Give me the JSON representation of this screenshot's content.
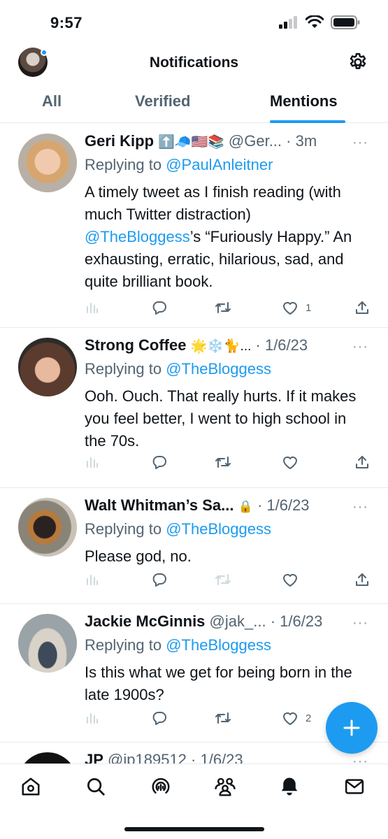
{
  "status_bar": {
    "time": "9:57"
  },
  "header": {
    "title": "Notifications"
  },
  "tabs": [
    {
      "label": "All",
      "active": false
    },
    {
      "label": "Verified",
      "active": false
    },
    {
      "label": "Mentions",
      "active": true
    }
  ],
  "tweets": [
    {
      "name": "Geri Kipp",
      "name_emoji": "⬆️🧢🇺🇸📚",
      "handle": "@Ger...",
      "time": "· 3m",
      "reply_prefix": "Replying to",
      "reply_to": "@PaulAnleitner",
      "body_parts": [
        "A timely tweet as I finish reading (with much Twitter distraction) ",
        "@TheBloggess",
        "’s “Furiously Happy.” An exhausting, erratic, hilarious, sad, and quite brilliant book."
      ],
      "likes": "1"
    },
    {
      "name": "Strong Coffee",
      "name_emoji": "🌟❄️🐈...",
      "handle": "",
      "time": "· 1/6/23",
      "reply_prefix": "Replying to",
      "reply_to": "@TheBloggess",
      "body": "Ooh. Ouch. That really hurts. If it makes you feel better, I went to high school in the 70s.",
      "likes": ""
    },
    {
      "name": "Walt Whitman’s Sa...",
      "name_emoji": "🔒",
      "handle": "",
      "time": "· 1/6/23",
      "reply_prefix": "Replying to",
      "reply_to": "@TheBloggess",
      "body": "Please god, no.",
      "likes": ""
    },
    {
      "name": "Jackie McGinnis",
      "name_emoji": "",
      "handle": "@jak_...",
      "time": "· 1/6/23",
      "reply_prefix": "Replying to",
      "reply_to": "@TheBloggess",
      "body": "Is this what we get for being born in the late 1900s?",
      "likes": "2"
    },
    {
      "name": "JP",
      "name_emoji": "",
      "handle": "@jp189512",
      "time": "· 1/6/23"
    }
  ],
  "more_label": "···",
  "colors": {
    "accent": "#1d9bf0",
    "text": "#0f1419",
    "muted": "#536471",
    "divider": "#e6e9ec"
  },
  "icons": {
    "header": [
      "settings-gear-icon"
    ],
    "tweet_actions": [
      "analytics-icon",
      "reply-icon",
      "retweet-icon",
      "like-icon",
      "share-icon"
    ],
    "tabbar": [
      "home-icon",
      "search-icon",
      "spaces-icon",
      "communities-icon",
      "notifications-bell-icon",
      "messages-icon"
    ],
    "fab": "compose-plus-icon"
  }
}
